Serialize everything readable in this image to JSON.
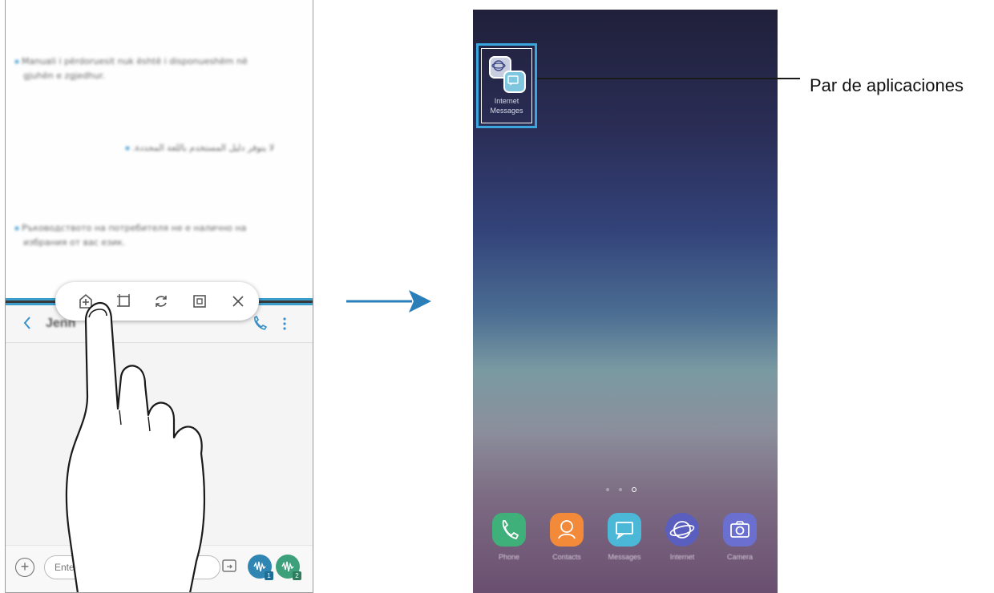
{
  "left_phone": {
    "top_pane": {
      "paragraphs": [
        "Manuali i përdoruesit nuk është i disponueshëm në",
        "gjuhën e zgjedhur.",
        "لا يتوفر دليل المستخدم باللغة المحددة.",
        "Ръководството на потребителя не е налично на",
        "избрания от вас език."
      ]
    },
    "app_bar": {
      "contact_name": "Jenn"
    },
    "composer": {
      "placeholder": "Enter message",
      "sim1": "1",
      "sim2": "2"
    }
  },
  "right_phone": {
    "app_pair": {
      "label_line1": "Internet",
      "label_line2": "Messages"
    },
    "callout": "Par de aplicaciones",
    "dock": [
      {
        "label": "Phone",
        "color": "#3fb07a"
      },
      {
        "label": "Contacts",
        "color": "#f28a3a"
      },
      {
        "label": "Messages",
        "color": "#4cb8d8"
      },
      {
        "label": "Internet",
        "color": "#5a5fbf"
      },
      {
        "label": "Camera",
        "color": "#6b6fd0"
      }
    ]
  },
  "colors": {
    "accent": "#3a9dcc",
    "arrow": "#2a7fb8"
  }
}
